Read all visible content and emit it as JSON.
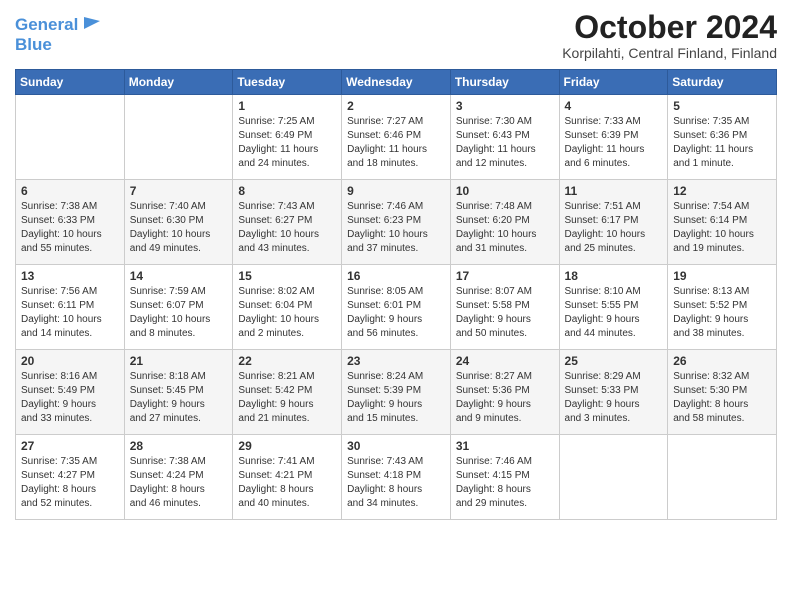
{
  "logo": {
    "line1": "General",
    "line2": "Blue"
  },
  "title": "October 2024",
  "subtitle": "Korpilahti, Central Finland, Finland",
  "header_days": [
    "Sunday",
    "Monday",
    "Tuesday",
    "Wednesday",
    "Thursday",
    "Friday",
    "Saturday"
  ],
  "weeks": [
    [
      {
        "day": "",
        "info": ""
      },
      {
        "day": "",
        "info": ""
      },
      {
        "day": "1",
        "info": "Sunrise: 7:25 AM\nSunset: 6:49 PM\nDaylight: 11 hours\nand 24 minutes."
      },
      {
        "day": "2",
        "info": "Sunrise: 7:27 AM\nSunset: 6:46 PM\nDaylight: 11 hours\nand 18 minutes."
      },
      {
        "day": "3",
        "info": "Sunrise: 7:30 AM\nSunset: 6:43 PM\nDaylight: 11 hours\nand 12 minutes."
      },
      {
        "day": "4",
        "info": "Sunrise: 7:33 AM\nSunset: 6:39 PM\nDaylight: 11 hours\nand 6 minutes."
      },
      {
        "day": "5",
        "info": "Sunrise: 7:35 AM\nSunset: 6:36 PM\nDaylight: 11 hours\nand 1 minute."
      }
    ],
    [
      {
        "day": "6",
        "info": "Sunrise: 7:38 AM\nSunset: 6:33 PM\nDaylight: 10 hours\nand 55 minutes."
      },
      {
        "day": "7",
        "info": "Sunrise: 7:40 AM\nSunset: 6:30 PM\nDaylight: 10 hours\nand 49 minutes."
      },
      {
        "day": "8",
        "info": "Sunrise: 7:43 AM\nSunset: 6:27 PM\nDaylight: 10 hours\nand 43 minutes."
      },
      {
        "day": "9",
        "info": "Sunrise: 7:46 AM\nSunset: 6:23 PM\nDaylight: 10 hours\nand 37 minutes."
      },
      {
        "day": "10",
        "info": "Sunrise: 7:48 AM\nSunset: 6:20 PM\nDaylight: 10 hours\nand 31 minutes."
      },
      {
        "day": "11",
        "info": "Sunrise: 7:51 AM\nSunset: 6:17 PM\nDaylight: 10 hours\nand 25 minutes."
      },
      {
        "day": "12",
        "info": "Sunrise: 7:54 AM\nSunset: 6:14 PM\nDaylight: 10 hours\nand 19 minutes."
      }
    ],
    [
      {
        "day": "13",
        "info": "Sunrise: 7:56 AM\nSunset: 6:11 PM\nDaylight: 10 hours\nand 14 minutes."
      },
      {
        "day": "14",
        "info": "Sunrise: 7:59 AM\nSunset: 6:07 PM\nDaylight: 10 hours\nand 8 minutes."
      },
      {
        "day": "15",
        "info": "Sunrise: 8:02 AM\nSunset: 6:04 PM\nDaylight: 10 hours\nand 2 minutes."
      },
      {
        "day": "16",
        "info": "Sunrise: 8:05 AM\nSunset: 6:01 PM\nDaylight: 9 hours\nand 56 minutes."
      },
      {
        "day": "17",
        "info": "Sunrise: 8:07 AM\nSunset: 5:58 PM\nDaylight: 9 hours\nand 50 minutes."
      },
      {
        "day": "18",
        "info": "Sunrise: 8:10 AM\nSunset: 5:55 PM\nDaylight: 9 hours\nand 44 minutes."
      },
      {
        "day": "19",
        "info": "Sunrise: 8:13 AM\nSunset: 5:52 PM\nDaylight: 9 hours\nand 38 minutes."
      }
    ],
    [
      {
        "day": "20",
        "info": "Sunrise: 8:16 AM\nSunset: 5:49 PM\nDaylight: 9 hours\nand 33 minutes."
      },
      {
        "day": "21",
        "info": "Sunrise: 8:18 AM\nSunset: 5:45 PM\nDaylight: 9 hours\nand 27 minutes."
      },
      {
        "day": "22",
        "info": "Sunrise: 8:21 AM\nSunset: 5:42 PM\nDaylight: 9 hours\nand 21 minutes."
      },
      {
        "day": "23",
        "info": "Sunrise: 8:24 AM\nSunset: 5:39 PM\nDaylight: 9 hours\nand 15 minutes."
      },
      {
        "day": "24",
        "info": "Sunrise: 8:27 AM\nSunset: 5:36 PM\nDaylight: 9 hours\nand 9 minutes."
      },
      {
        "day": "25",
        "info": "Sunrise: 8:29 AM\nSunset: 5:33 PM\nDaylight: 9 hours\nand 3 minutes."
      },
      {
        "day": "26",
        "info": "Sunrise: 8:32 AM\nSunset: 5:30 PM\nDaylight: 8 hours\nand 58 minutes."
      }
    ],
    [
      {
        "day": "27",
        "info": "Sunrise: 7:35 AM\nSunset: 4:27 PM\nDaylight: 8 hours\nand 52 minutes."
      },
      {
        "day": "28",
        "info": "Sunrise: 7:38 AM\nSunset: 4:24 PM\nDaylight: 8 hours\nand 46 minutes."
      },
      {
        "day": "29",
        "info": "Sunrise: 7:41 AM\nSunset: 4:21 PM\nDaylight: 8 hours\nand 40 minutes."
      },
      {
        "day": "30",
        "info": "Sunrise: 7:43 AM\nSunset: 4:18 PM\nDaylight: 8 hours\nand 34 minutes."
      },
      {
        "day": "31",
        "info": "Sunrise: 7:46 AM\nSunset: 4:15 PM\nDaylight: 8 hours\nand 29 minutes."
      },
      {
        "day": "",
        "info": ""
      },
      {
        "day": "",
        "info": ""
      }
    ]
  ]
}
